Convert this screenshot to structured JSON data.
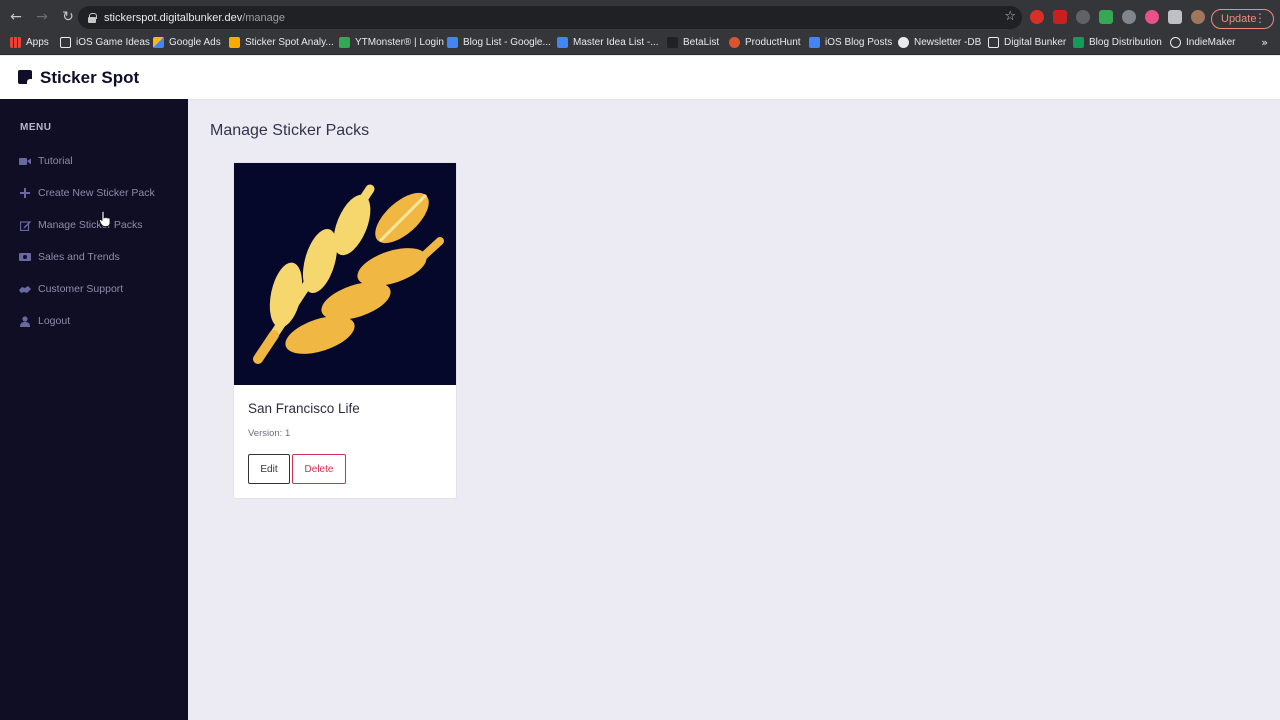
{
  "browser": {
    "url_host": "stickerspot.digitalbunker.dev",
    "url_path": "/manage",
    "update_label": "Update",
    "bookmarks": [
      {
        "label": "Apps",
        "icon": "apps-grid-icon"
      },
      {
        "label": "iOS Game Ideas",
        "icon": "folder-icon"
      },
      {
        "label": "Google Ads",
        "icon": "google-ads-icon"
      },
      {
        "label": "Sticker Spot Analy...",
        "icon": "analytics-icon"
      },
      {
        "label": "YTMonster® | Login",
        "icon": "ytmonster-icon"
      },
      {
        "label": "Blog List - Google...",
        "icon": "google-docs-icon"
      },
      {
        "label": "Master Idea List -...",
        "icon": "google-docs-icon"
      },
      {
        "label": "BetaList",
        "icon": "betalist-icon"
      },
      {
        "label": "ProductHunt",
        "icon": "producthunt-icon"
      },
      {
        "label": "iOS Blog Posts",
        "icon": "google-docs-icon"
      },
      {
        "label": "Newsletter -DB",
        "icon": "globe-icon"
      },
      {
        "label": "Digital Bunker",
        "icon": "folder-icon"
      },
      {
        "label": "Blog Distribution",
        "icon": "google-sheets-icon"
      },
      {
        "label": "IndieMaker",
        "icon": "indiemaker-icon"
      }
    ],
    "more_label": "»"
  },
  "app": {
    "name": "Sticker Spot"
  },
  "sidebar": {
    "heading": "MENU",
    "items": [
      {
        "label": "Tutorial",
        "icon": "video-camera-icon"
      },
      {
        "label": "Create New Sticker Pack",
        "icon": "plus-icon"
      },
      {
        "label": "Manage Sticker Packs",
        "icon": "edit-icon"
      },
      {
        "label": "Sales and Trends",
        "icon": "money-icon"
      },
      {
        "label": "Customer Support",
        "icon": "handshake-icon"
      },
      {
        "label": "Logout",
        "icon": "user-icon"
      }
    ]
  },
  "main": {
    "title": "Manage Sticker Packs",
    "packs": [
      {
        "name": "San Francisco Life",
        "version": "Version: 1",
        "image": "wheat-icon",
        "edit_label": "Edit",
        "delete_label": "Delete"
      }
    ]
  },
  "colors": {
    "sidebar_bg": "#0f0e24",
    "page_bg": "#ecebf4",
    "delete_accent": "#d0314f",
    "sticker_bg": "#06082b",
    "wheat_light": "#f5d76e",
    "wheat_dark": "#f0b743"
  }
}
